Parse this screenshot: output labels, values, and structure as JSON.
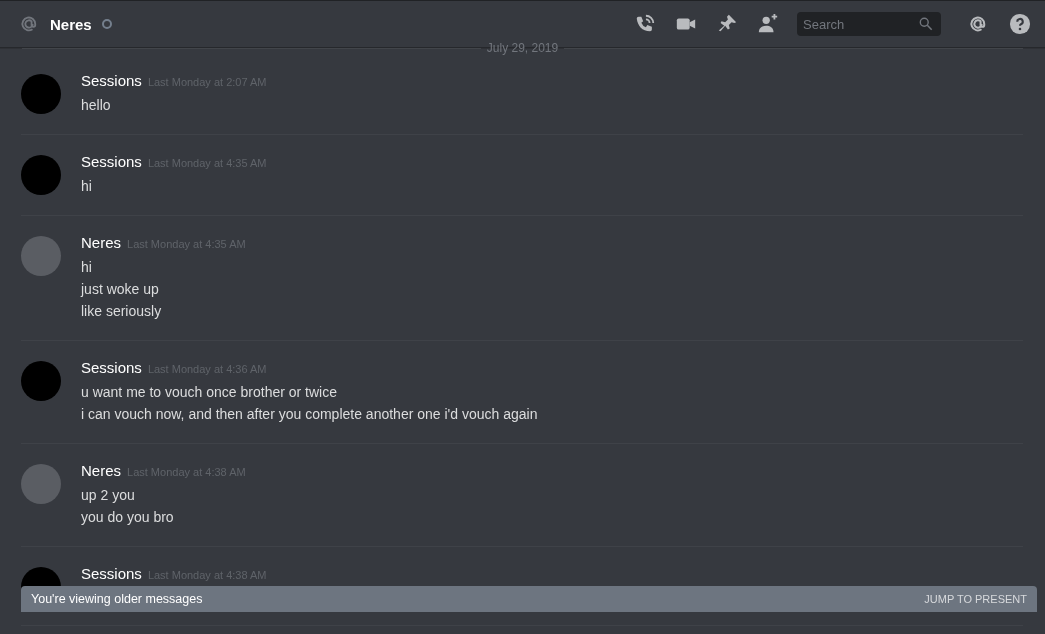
{
  "header": {
    "channel_name": "Neres",
    "search": {
      "placeholder": "Search"
    }
  },
  "date_divider": "July 29, 2019",
  "messages": [
    {
      "author": "Sessions",
      "color": "#000000",
      "timestamp": "Last Monday at 2:07 AM",
      "lines": [
        "hello"
      ]
    },
    {
      "author": "Sessions",
      "color": "#000000",
      "timestamp": "Last Monday at 4:35 AM",
      "lines": [
        "hi"
      ]
    },
    {
      "author": "Neres",
      "color": "#5a5d63",
      "timestamp": "Last Monday at 4:35 AM",
      "lines": [
        "hi",
        "just woke up",
        "like seriously"
      ]
    },
    {
      "author": "Sessions",
      "color": "#000000",
      "timestamp": "Last Monday at 4:36 AM",
      "lines": [
        "u want me to vouch once brother or twice",
        "i can vouch now, and then after you complete another one i'd vouch again"
      ]
    },
    {
      "author": "Neres",
      "color": "#5a5d63",
      "timestamp": "Last Monday at 4:38 AM",
      "lines": [
        "up 2 you",
        "you do you bro"
      ]
    },
    {
      "author": "Sessions",
      "color": "#000000",
      "timestamp": "Last Monday at 4:38 AM"
    }
  ],
  "older_banner": {
    "text": "You're viewing older messages",
    "action": "JUMP TO PRESENT"
  }
}
